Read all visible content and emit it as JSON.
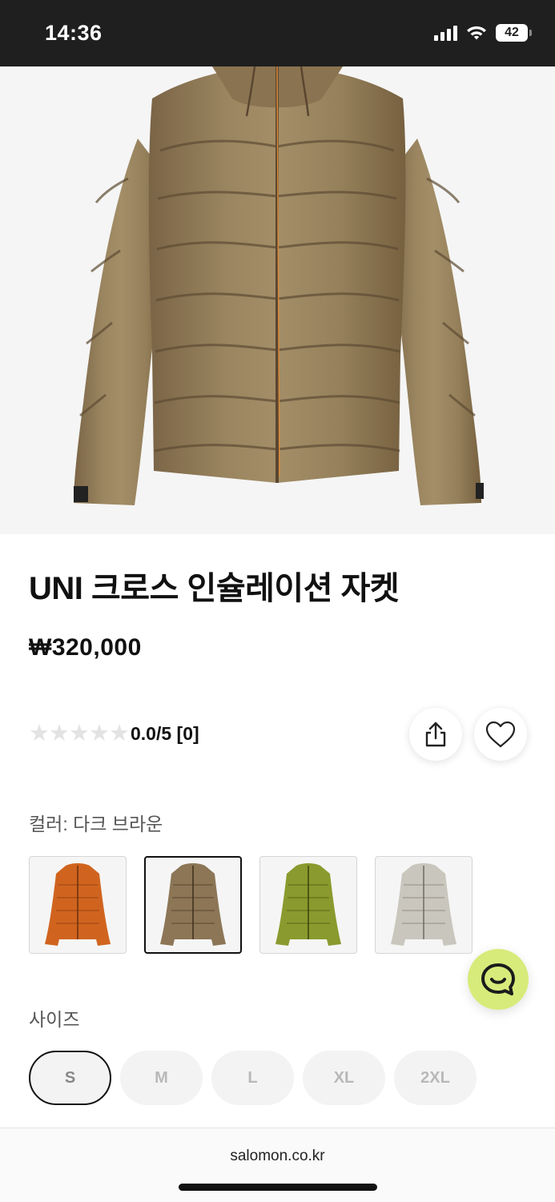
{
  "status_bar": {
    "time": "14:36",
    "battery": "42",
    "icons": [
      "signal-icon",
      "wifi-icon",
      "battery-icon"
    ]
  },
  "product": {
    "title": "UNI 크로스 인슐레이션 자켓",
    "price": "₩320,000",
    "rating_text": "0.0/5 [0]",
    "rating_value": 0,
    "rating_max": 5
  },
  "actions": {
    "share_icon": "share-icon",
    "wishlist_icon": "heart-icon"
  },
  "color": {
    "label": "컬러: 다크 브라운",
    "selected_index": 1,
    "swatches": [
      {
        "color": "#d0641f"
      },
      {
        "color": "#8c7656"
      },
      {
        "color": "#8a9a2e"
      },
      {
        "color": "#c9c6bd"
      }
    ]
  },
  "size": {
    "label": "사이즈",
    "options": [
      "S",
      "M",
      "L",
      "XL",
      "2XL"
    ],
    "selected_index": 0
  },
  "browser": {
    "url": "salomon.co.kr"
  },
  "colors": {
    "chat_fab": "#d7eb7b",
    "product_main": "#8c7656"
  }
}
